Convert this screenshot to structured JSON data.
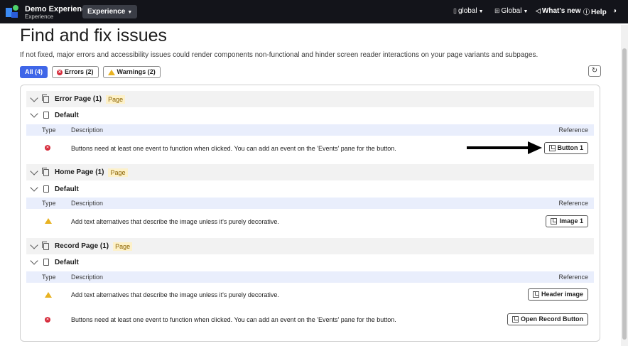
{
  "topbar": {
    "app_title": "Demo Experience",
    "app_subtitle": "Experience",
    "experience_menu": "Experience",
    "scope_menu": "global",
    "language_menu": "Global",
    "whats_new": "What's new",
    "help": "Help"
  },
  "page": {
    "title": "Find and fix issues",
    "description": "If not fixed, major errors and accessibility issues could render components non-functional and hinder screen reader interactions on your page variants and subpages."
  },
  "filters": {
    "all": "All (4)",
    "errors": "Errors (2)",
    "warnings": "Warnings (2)"
  },
  "columns": {
    "type": "Type",
    "description": "Description",
    "reference": "Reference"
  },
  "groups": [
    {
      "page_name": "Error Page (1)",
      "badge": "Page",
      "variant": "Default",
      "rows": [
        {
          "type": "error",
          "description": "Buttons need at least one event to function when clicked. You can add an event on the 'Events' pane for the button.",
          "reference": "Button 1"
        }
      ]
    },
    {
      "page_name": "Home Page (1)",
      "badge": "Page",
      "variant": "Default",
      "rows": [
        {
          "type": "warning",
          "description": "Add text alternatives that describe the image unless it's purely decorative.",
          "reference": "Image 1"
        }
      ]
    },
    {
      "page_name": "Record Page (1)",
      "badge": "Page",
      "variant": "Default",
      "rows": [
        {
          "type": "warning",
          "description": "Add text alternatives that describe the image unless it's purely decorative.",
          "reference": "Header image"
        },
        {
          "type": "error",
          "description": "Buttons need at least one event to function when clicked. You can add an event on the 'Events' pane for the button.",
          "reference": "Open Record Button"
        }
      ]
    }
  ],
  "colors": {
    "topbar": "#13141a",
    "accent": "#3f66e8",
    "error": "#d62a3a",
    "warning": "#e8b222",
    "badge_bg": "#fdf1c9"
  }
}
